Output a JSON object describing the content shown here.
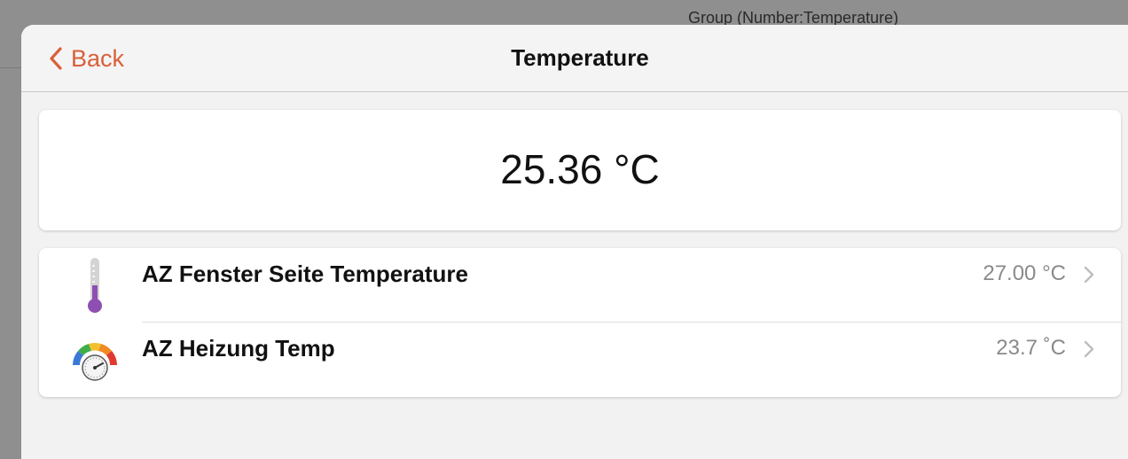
{
  "backdrop": {
    "title": "Group (Number:Temperature)"
  },
  "navbar": {
    "back_label": "Back",
    "title": "Temperature"
  },
  "summary": {
    "value": "25.36 °C"
  },
  "items": [
    {
      "label": "AZ Fenster Seite Temperature",
      "value": "27.00 °C",
      "icon": "thermometer-icon"
    },
    {
      "label": "AZ Heizung Temp",
      "value": "23.7 ˚C",
      "icon": "gauge-icon"
    }
  ],
  "colors": {
    "accent": "#d9603a",
    "thermometer_fill": "#8e4fb3",
    "gauge_blue": "#3a78d6",
    "gauge_green": "#3fae4a",
    "gauge_yellow": "#f2c12e",
    "gauge_orange": "#f08a24",
    "gauge_red": "#e03a2f"
  }
}
